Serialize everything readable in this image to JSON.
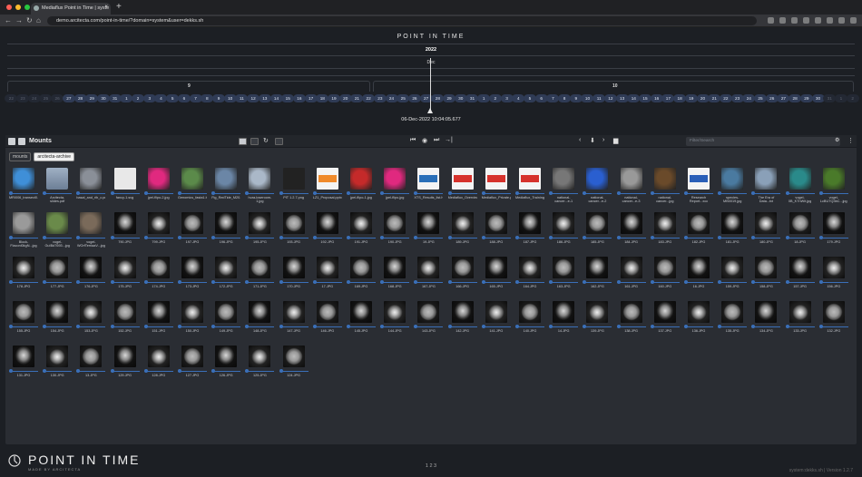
{
  "browser": {
    "tab_title": "Mediaflux Point in Time | syste",
    "url": "demo.arcitecta.com/point-in-time/?domain=system&user=dekks.sh"
  },
  "app": {
    "title": "POINT IN TIME"
  },
  "timeline": {
    "year": "2022",
    "month": "Dec",
    "week_labels": [
      "9",
      "10"
    ],
    "days": [
      "22",
      "23",
      "24",
      "25",
      "26",
      "27",
      "28",
      "29",
      "30",
      "31",
      "1",
      "2",
      "3",
      "4",
      "5",
      "6",
      "7",
      "8",
      "9",
      "10",
      "11",
      "12",
      "13",
      "14",
      "15",
      "16",
      "17",
      "18",
      "19",
      "20",
      "21",
      "22",
      "23",
      "24",
      "25",
      "26",
      "27",
      "28",
      "29",
      "30",
      "31",
      "1",
      "2",
      "3",
      "4",
      "5",
      "6",
      "7",
      "8",
      "9",
      "10",
      "11",
      "12",
      "13",
      "14",
      "15",
      "16",
      "17",
      "18",
      "19",
      "20",
      "21",
      "22",
      "23",
      "24",
      "25",
      "26",
      "27",
      "28",
      "29",
      "30",
      "31",
      "1",
      "2"
    ],
    "cursor_label": "06-Dec-2022 10:04:05.677"
  },
  "panel": {
    "title": "Mounts",
    "filter_placeholder": "Filter/Search",
    "breadcrumb": [
      "mounts",
      "arcitecta-archive"
    ]
  },
  "files": [
    {
      "label": "MRI006_transect0.png",
      "kind": "img",
      "color": "#3f8fd8"
    },
    {
      "label": "Arcitecta-slides.pdf",
      "kind": "folder",
      "color": "#8a97a8"
    },
    {
      "label": "basal_and_rib_c.png",
      "kind": "img",
      "color": "#8a8f98"
    },
    {
      "label": "fancy-1.svg",
      "kind": "unknown",
      "color": "#e6e6e6"
    },
    {
      "label": "jpel-flipo-2.jpg",
      "kind": "img",
      "color": "#e0297f"
    },
    {
      "label": "Genomics_fasta1.bin",
      "kind": "img",
      "color": "#5b8a4a"
    },
    {
      "label": "Fig_RedTide_M20.jpg",
      "kind": "img",
      "color": "#6b86a6"
    },
    {
      "label": "hura-loseroom-1.jpg",
      "kind": "img",
      "color": "#aab8c8"
    },
    {
      "label": "PIT 1.2.7.png",
      "kind": "img",
      "color": "#222"
    },
    {
      "label": "LZ1_Proposal.pptx",
      "kind": "ppt",
      "color": "#f08a2a"
    },
    {
      "label": "jpel-flipo-1.jpg",
      "kind": "img",
      "color": "#c52a2a"
    },
    {
      "label": "jpel-flipo.jpg",
      "kind": "img",
      "color": "#e0297f"
    },
    {
      "label": "XTS_Results_list.html",
      "kind": "html",
      "color": "#2a6fb8"
    },
    {
      "label": "Mediaflux_Overview.pdf",
      "kind": "pdf",
      "color": "#d6322c"
    },
    {
      "label": "Mediaflux_Private.pdf",
      "kind": "pdf",
      "color": "#d6322c"
    },
    {
      "label": "Mediaflux_Training.pdf",
      "kind": "pdf",
      "color": "#d6322c"
    },
    {
      "label": "national-cancer...e-1",
      "kind": "img",
      "color": "#777"
    },
    {
      "label": "national-cancer...e-2",
      "kind": "img",
      "color": "#2a5fd0"
    },
    {
      "label": "national-cancer...e-3",
      "kind": "img",
      "color": "#999"
    },
    {
      "label": "national-cancer...jpg",
      "kind": "img",
      "color": "#6a4a2a"
    },
    {
      "label": "Research Report...xcc",
      "kind": "word",
      "color": "#2a5fb8"
    },
    {
      "label": "species-MB0019.jpg",
      "kind": "img",
      "color": "#4a7aa0"
    },
    {
      "label": "The Era of Data...txt",
      "kind": "img",
      "color": "#8aa0b8"
    },
    {
      "label": "vogel-0B_KTnWit.jpg",
      "kind": "img",
      "color": "#2a8a8a"
    },
    {
      "label": "vogel-LcBUTQ3bC...jpg",
      "kind": "img",
      "color": "#4a7a2a"
    },
    {
      "label": "Block-Fiaconl0kgN...jpg",
      "kind": "img",
      "color": "#9a9a9a"
    },
    {
      "label": "vogel-GuIBd7693...jpg",
      "kind": "img",
      "color": "#6a8a4a"
    },
    {
      "label": "vogel-WOrfTerriaaV...jpg",
      "kind": "img",
      "color": "#7a6a5a"
    },
    {
      "label": "790.JPG",
      "kind": "scan"
    },
    {
      "label": "799.JPG",
      "kind": "scan"
    },
    {
      "label": "197.JPG",
      "kind": "scan"
    },
    {
      "label": "196.JPG",
      "kind": "scan"
    },
    {
      "label": "195.JPG",
      "kind": "scan"
    },
    {
      "label": "193.JPG",
      "kind": "scan"
    },
    {
      "label": "192.JPG",
      "kind": "scan"
    },
    {
      "label": "191.JPG",
      "kind": "scan"
    },
    {
      "label": "190.JPG",
      "kind": "scan"
    },
    {
      "label": "19.JPG",
      "kind": "scan"
    },
    {
      "label": "189.JPG",
      "kind": "scan"
    },
    {
      "label": "188.JPG",
      "kind": "scan"
    },
    {
      "label": "187.JPG",
      "kind": "scan"
    },
    {
      "label": "186.JPG",
      "kind": "scan"
    },
    {
      "label": "185.JPG",
      "kind": "scan"
    },
    {
      "label": "184.JPG",
      "kind": "scan"
    },
    {
      "label": "183.JPG",
      "kind": "scan"
    },
    {
      "label": "182.JPG",
      "kind": "scan"
    },
    {
      "label": "181.JPG",
      "kind": "scan"
    },
    {
      "label": "180.JPG",
      "kind": "scan"
    },
    {
      "label": "18.JPG",
      "kind": "scan"
    },
    {
      "label": "179.JPG",
      "kind": "scan"
    },
    {
      "label": "178.JPG",
      "kind": "scan"
    },
    {
      "label": "177.JPG",
      "kind": "scan"
    },
    {
      "label": "176.JPG",
      "kind": "scan"
    },
    {
      "label": "175.JPG",
      "kind": "scan"
    },
    {
      "label": "174.JPG",
      "kind": "scan"
    },
    {
      "label": "173.JPG",
      "kind": "scan"
    },
    {
      "label": "172.JPG",
      "kind": "scan"
    },
    {
      "label": "171.JPG",
      "kind": "scan"
    },
    {
      "label": "170.JPG",
      "kind": "scan"
    },
    {
      "label": "17.JPG",
      "kind": "scan"
    },
    {
      "label": "169.JPG",
      "kind": "scan"
    },
    {
      "label": "168.JPG",
      "kind": "scan"
    },
    {
      "label": "167.JPG",
      "kind": "scan"
    },
    {
      "label": "166.JPG",
      "kind": "scan"
    },
    {
      "label": "165.JPG",
      "kind": "scan"
    },
    {
      "label": "164.JPG",
      "kind": "scan"
    },
    {
      "label": "163.JPG",
      "kind": "scan"
    },
    {
      "label": "162.JPG",
      "kind": "scan"
    },
    {
      "label": "161.JPG",
      "kind": "scan"
    },
    {
      "label": "160.JPG",
      "kind": "scan"
    },
    {
      "label": "16.JPG",
      "kind": "scan"
    },
    {
      "label": "159.JPG",
      "kind": "scan"
    },
    {
      "label": "158.JPG",
      "kind": "scan"
    },
    {
      "label": "157.JPG",
      "kind": "scan"
    },
    {
      "label": "156.JPG",
      "kind": "scan"
    },
    {
      "label": "155.JPG",
      "kind": "scan"
    },
    {
      "label": "154.JPG",
      "kind": "scan"
    },
    {
      "label": "153.JPG",
      "kind": "scan"
    },
    {
      "label": "152.JPG",
      "kind": "scan"
    },
    {
      "label": "151.JPG",
      "kind": "scan"
    },
    {
      "label": "150.JPG",
      "kind": "scan"
    },
    {
      "label": "149.JPG",
      "kind": "scan"
    },
    {
      "label": "148.JPG",
      "kind": "scan"
    },
    {
      "label": "147.JPG",
      "kind": "scan"
    },
    {
      "label": "146.JPG",
      "kind": "scan"
    },
    {
      "label": "145.JPG",
      "kind": "scan"
    },
    {
      "label": "144.JPG",
      "kind": "scan"
    },
    {
      "label": "143.JPG",
      "kind": "scan"
    },
    {
      "label": "142.JPG",
      "kind": "scan"
    },
    {
      "label": "141.JPG",
      "kind": "scan"
    },
    {
      "label": "140.JPG",
      "kind": "scan"
    },
    {
      "label": "14.JPG",
      "kind": "scan"
    },
    {
      "label": "139.JPG",
      "kind": "scan"
    },
    {
      "label": "138.JPG",
      "kind": "scan"
    },
    {
      "label": "137.JPG",
      "kind": "scan"
    },
    {
      "label": "136.JPG",
      "kind": "scan"
    },
    {
      "label": "135.JPG",
      "kind": "scan"
    },
    {
      "label": "134.JPG",
      "kind": "scan"
    },
    {
      "label": "133.JPG",
      "kind": "scan"
    },
    {
      "label": "132.JPG",
      "kind": "scan"
    },
    {
      "label": "131.JPG",
      "kind": "scan"
    },
    {
      "label": "130.JPG",
      "kind": "scan"
    },
    {
      "label": "13.JPG",
      "kind": "scan"
    },
    {
      "label": "129.JPG",
      "kind": "scan"
    },
    {
      "label": "128.JPG",
      "kind": "scan"
    },
    {
      "label": "127.JPG",
      "kind": "scan"
    },
    {
      "label": "126.JPG",
      "kind": "scan"
    },
    {
      "label": "125.JPG",
      "kind": "scan"
    },
    {
      "label": "124.JPG",
      "kind": "scan"
    }
  ],
  "pager": "1 2 3",
  "brand": {
    "name": "POINT IN TIME",
    "tagline": "MADE BY ARCITECTA"
  },
  "footer": {
    "right": "system:dekks.sh  |  Version 1.2.7"
  }
}
